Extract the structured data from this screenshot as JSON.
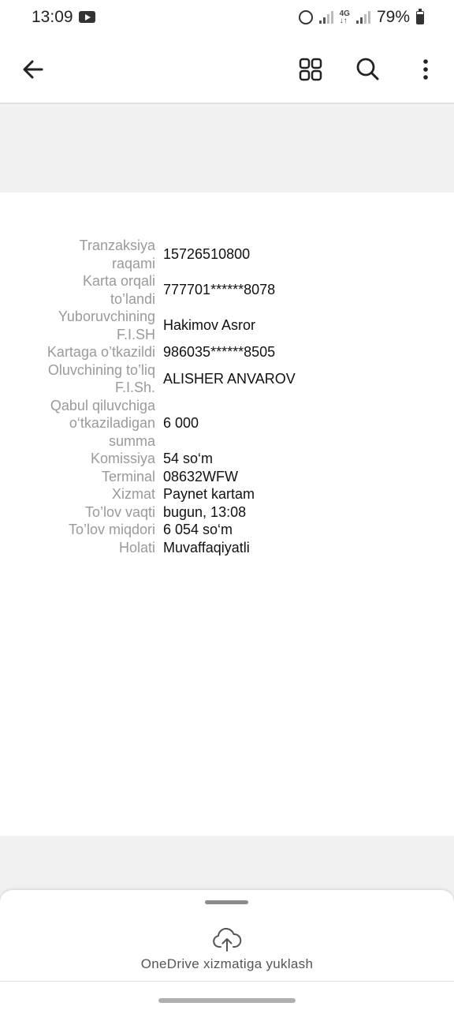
{
  "status_bar": {
    "time": "13:09",
    "battery": "79%",
    "icons": [
      "youtube-icon",
      "alarm-icon",
      "signal-icon",
      "4g-icon",
      "battery-icon"
    ]
  },
  "app_bar": {
    "icons": [
      "back-arrow-icon",
      "grid-view-icon",
      "search-icon",
      "more-vert-icon"
    ]
  },
  "receipt": {
    "rows": [
      {
        "label_lines": [
          "Tranzaksiya",
          "raqami"
        ],
        "value": "15726510800"
      },
      {
        "label_lines": [
          "Karta orqali",
          "to’landi"
        ],
        "value": "777701******8078"
      },
      {
        "label_lines": [
          "Yuboruvchining",
          "F.I.SH"
        ],
        "value": "Hakimov Asror"
      },
      {
        "label_lines": [
          "Kartaga o’tkazildi"
        ],
        "value": "986035******8505"
      },
      {
        "label_lines": [
          "Oluvchining to’liq",
          "F.I.Sh."
        ],
        "value": "ALISHER ANVAROV"
      },
      {
        "label_lines": [
          "Qabul qiluvchiga",
          "o‘tkaziladigan",
          "summa"
        ],
        "value": "6 000"
      },
      {
        "label_lines": [
          "Komissiya"
        ],
        "value": "54 so‘m"
      },
      {
        "label_lines": [
          "Terminal"
        ],
        "value": "08632WFW"
      },
      {
        "label_lines": [
          "Xizmat"
        ],
        "value": "Paynet kartam"
      },
      {
        "label_lines": [
          "To’lov vaqti"
        ],
        "value": "bugun, 13:08"
      },
      {
        "label_lines": [
          "To’lov miqdori"
        ],
        "value": "6 054 so‘m"
      },
      {
        "label_lines": [
          "Holati"
        ],
        "value": "Muvaffaqiyatli"
      }
    ]
  },
  "bottom_sheet": {
    "upload_label": "OneDrive xizmatiga yuklash",
    "icon": "cloud-upload-icon"
  }
}
